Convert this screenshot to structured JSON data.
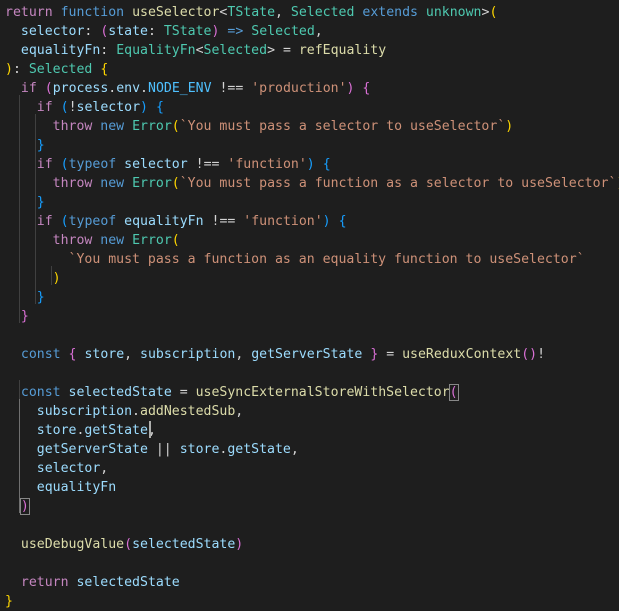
{
  "editor": {
    "theme_colors": {
      "background": "#1e1e1e",
      "keyword": "#569cd6",
      "control": "#c586c0",
      "function": "#dcdcaa",
      "type": "#4ec9b0",
      "variable": "#9cdcfe",
      "constant": "#4fc1ff",
      "string": "#ce9178",
      "bracket_1": "#ffd700",
      "bracket_2": "#da70d6",
      "bracket_3": "#179fff"
    },
    "lines": [
      [
        [
          "ctl",
          "return"
        ],
        [
          "p",
          " "
        ],
        [
          "kw",
          "function"
        ],
        [
          "p",
          " "
        ],
        [
          "fn",
          "useSelector"
        ],
        [
          "p",
          "<"
        ],
        [
          "ty",
          "TState"
        ],
        [
          "p",
          ", "
        ],
        [
          "ty",
          "Selected"
        ],
        [
          "p",
          " "
        ],
        [
          "kw",
          "extends"
        ],
        [
          "p",
          " "
        ],
        [
          "ty",
          "unknown"
        ],
        [
          "p",
          ">"
        ],
        [
          "b1",
          "("
        ]
      ],
      [
        [
          "p",
          "  "
        ],
        [
          "var",
          "selector"
        ],
        [
          "p",
          ": "
        ],
        [
          "b2",
          "("
        ],
        [
          "var",
          "state"
        ],
        [
          "p",
          ": "
        ],
        [
          "ty",
          "TState"
        ],
        [
          "b2",
          ")"
        ],
        [
          "p",
          " "
        ],
        [
          "kw",
          "=>"
        ],
        [
          "p",
          " "
        ],
        [
          "ty",
          "Selected"
        ],
        [
          "p",
          ","
        ]
      ],
      [
        [
          "p",
          "  "
        ],
        [
          "var",
          "equalityFn"
        ],
        [
          "p",
          ": "
        ],
        [
          "ty",
          "EqualityFn"
        ],
        [
          "p",
          "<"
        ],
        [
          "ty",
          "Selected"
        ],
        [
          "p",
          "> = "
        ],
        [
          "fn",
          "refEquality"
        ]
      ],
      [
        [
          "b1",
          ")"
        ],
        [
          "p",
          ": "
        ],
        [
          "ty",
          "Selected"
        ],
        [
          "p",
          " "
        ],
        [
          "b1",
          "{"
        ]
      ],
      [
        [
          "p",
          "  "
        ],
        [
          "ctl",
          "if"
        ],
        [
          "p",
          " "
        ],
        [
          "b2",
          "("
        ],
        [
          "var",
          "process"
        ],
        [
          "p",
          "."
        ],
        [
          "var",
          "env"
        ],
        [
          "p",
          "."
        ],
        [
          "const",
          "NODE_ENV"
        ],
        [
          "p",
          " !== "
        ],
        [
          "str",
          "'production'"
        ],
        [
          "b2",
          ")"
        ],
        [
          "p",
          " "
        ],
        [
          "b2",
          "{"
        ]
      ],
      [
        [
          "p",
          "    "
        ],
        [
          "ctl",
          "if"
        ],
        [
          "p",
          " "
        ],
        [
          "b3",
          "("
        ],
        [
          "p",
          "!"
        ],
        [
          "var",
          "selector"
        ],
        [
          "b3",
          ")"
        ],
        [
          "p",
          " "
        ],
        [
          "b3",
          "{"
        ]
      ],
      [
        [
          "p",
          "      "
        ],
        [
          "ctl",
          "throw"
        ],
        [
          "p",
          " "
        ],
        [
          "kw",
          "new"
        ],
        [
          "p",
          " "
        ],
        [
          "ty",
          "Error"
        ],
        [
          "b1",
          "("
        ],
        [
          "str",
          "`You must pass a selector to useSelector`"
        ],
        [
          "b1",
          ")"
        ]
      ],
      [
        [
          "p",
          "    "
        ],
        [
          "b3",
          "}"
        ]
      ],
      [
        [
          "p",
          "    "
        ],
        [
          "ctl",
          "if"
        ],
        [
          "p",
          " "
        ],
        [
          "b3",
          "("
        ],
        [
          "kw",
          "typeof"
        ],
        [
          "p",
          " "
        ],
        [
          "var",
          "selector"
        ],
        [
          "p",
          " !== "
        ],
        [
          "str",
          "'function'"
        ],
        [
          "b3",
          ")"
        ],
        [
          "p",
          " "
        ],
        [
          "b3",
          "{"
        ]
      ],
      [
        [
          "p",
          "      "
        ],
        [
          "ctl",
          "throw"
        ],
        [
          "p",
          " "
        ],
        [
          "kw",
          "new"
        ],
        [
          "p",
          " "
        ],
        [
          "ty",
          "Error"
        ],
        [
          "b1",
          "("
        ],
        [
          "str",
          "`You must pass a function as a selector to useSelector`"
        ],
        [
          "b1",
          ")"
        ]
      ],
      [
        [
          "p",
          "    "
        ],
        [
          "b3",
          "}"
        ]
      ],
      [
        [
          "p",
          "    "
        ],
        [
          "ctl",
          "if"
        ],
        [
          "p",
          " "
        ],
        [
          "b3",
          "("
        ],
        [
          "kw",
          "typeof"
        ],
        [
          "p",
          " "
        ],
        [
          "var",
          "equalityFn"
        ],
        [
          "p",
          " !== "
        ],
        [
          "str",
          "'function'"
        ],
        [
          "b3",
          ")"
        ],
        [
          "p",
          " "
        ],
        [
          "b3",
          "{"
        ]
      ],
      [
        [
          "p",
          "      "
        ],
        [
          "ctl",
          "throw"
        ],
        [
          "p",
          " "
        ],
        [
          "kw",
          "new"
        ],
        [
          "p",
          " "
        ],
        [
          "ty",
          "Error"
        ],
        [
          "b1",
          "("
        ]
      ],
      [
        [
          "p",
          "        "
        ],
        [
          "str",
          "`You must pass a function as an equality function to useSelector`"
        ]
      ],
      [
        [
          "p",
          "      "
        ],
        [
          "b1",
          ")"
        ]
      ],
      [
        [
          "p",
          "    "
        ],
        [
          "b3",
          "}"
        ]
      ],
      [
        [
          "p",
          "  "
        ],
        [
          "b2",
          "}"
        ]
      ],
      [],
      [
        [
          "p",
          "  "
        ],
        [
          "kw",
          "const"
        ],
        [
          "p",
          " "
        ],
        [
          "b2",
          "{"
        ],
        [
          "p",
          " "
        ],
        [
          "var",
          "store"
        ],
        [
          "p",
          ", "
        ],
        [
          "var",
          "subscription"
        ],
        [
          "p",
          ", "
        ],
        [
          "var",
          "getServerState"
        ],
        [
          "p",
          " "
        ],
        [
          "b2",
          "}"
        ],
        [
          "p",
          " = "
        ],
        [
          "fn",
          "useReduxContext"
        ],
        [
          "b2",
          "("
        ],
        [
          "b2",
          ")"
        ],
        [
          "p",
          "!"
        ]
      ],
      [],
      [
        [
          "p",
          "  "
        ],
        [
          "kw",
          "const"
        ],
        [
          "p",
          " "
        ],
        [
          "var",
          "selectedState"
        ],
        [
          "p",
          " = "
        ],
        [
          "fn",
          "useSyncExternalStoreWithSelector"
        ],
        [
          "b2",
          "("
        ]
      ],
      [
        [
          "p",
          "    "
        ],
        [
          "var",
          "subscription"
        ],
        [
          "p",
          "."
        ],
        [
          "fn",
          "addNestedSub"
        ],
        [
          "p",
          ","
        ]
      ],
      [
        [
          "p",
          "    "
        ],
        [
          "var",
          "store"
        ],
        [
          "p",
          "."
        ],
        [
          "var",
          "getState"
        ],
        [
          "p",
          ","
        ]
      ],
      [
        [
          "p",
          "    "
        ],
        [
          "var",
          "getServerState"
        ],
        [
          "p",
          " || "
        ],
        [
          "var",
          "store"
        ],
        [
          "p",
          "."
        ],
        [
          "var",
          "getState"
        ],
        [
          "p",
          ","
        ]
      ],
      [
        [
          "p",
          "    "
        ],
        [
          "var",
          "selector"
        ],
        [
          "p",
          ","
        ]
      ],
      [
        [
          "p",
          "    "
        ],
        [
          "var",
          "equalityFn"
        ]
      ],
      [
        [
          "p",
          "  "
        ],
        [
          "b2",
          ")"
        ]
      ],
      [],
      [
        [
          "p",
          "  "
        ],
        [
          "fn",
          "useDebugValue"
        ],
        [
          "b2",
          "("
        ],
        [
          "var",
          "selectedState"
        ],
        [
          "b2",
          ")"
        ]
      ],
      [],
      [
        [
          "p",
          "  "
        ],
        [
          "ctl",
          "return"
        ],
        [
          "p",
          " "
        ],
        [
          "var",
          "selectedState"
        ]
      ],
      [
        [
          "b1",
          "}"
        ]
      ]
    ]
  }
}
